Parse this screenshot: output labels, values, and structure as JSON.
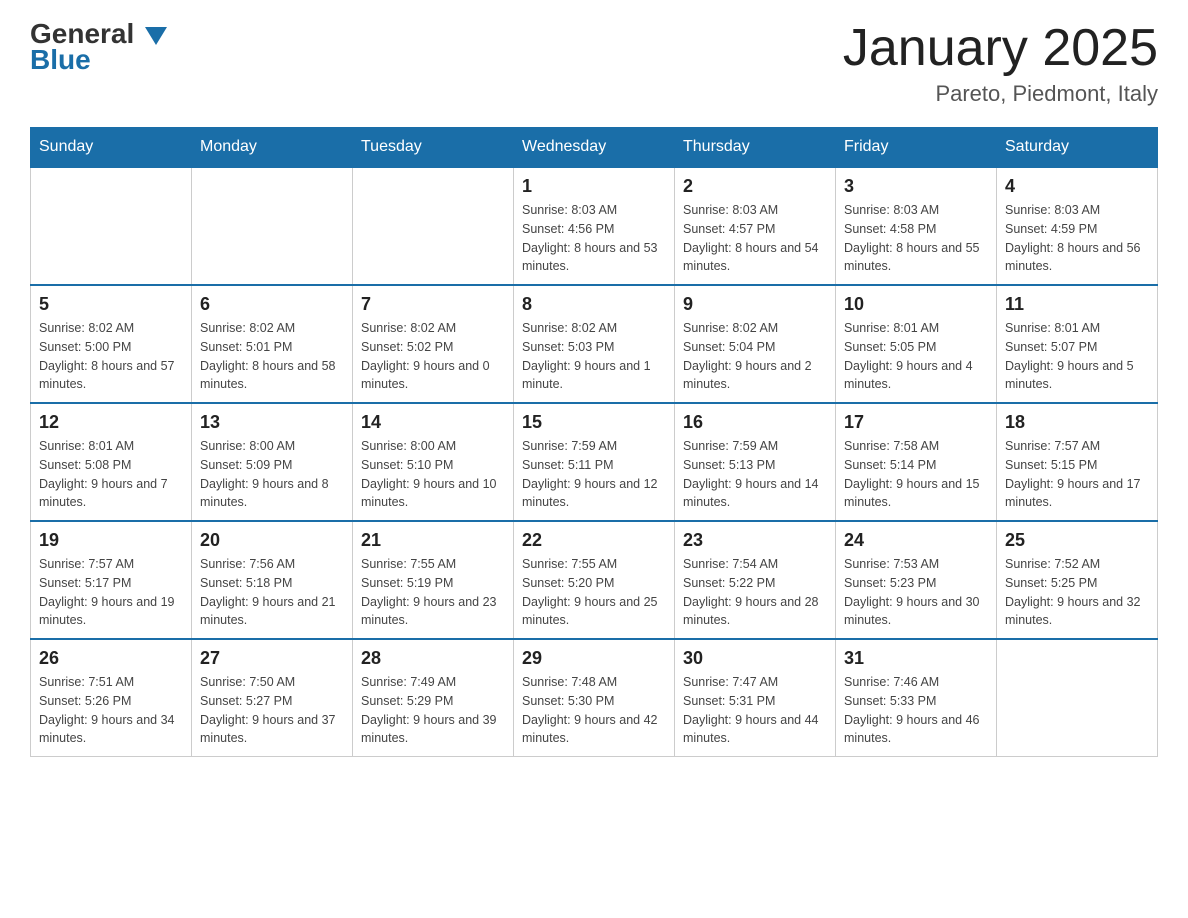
{
  "header": {
    "logo_general": "General",
    "logo_blue": "Blue",
    "title": "January 2025",
    "subtitle": "Pareto, Piedmont, Italy"
  },
  "days_of_week": [
    "Sunday",
    "Monday",
    "Tuesday",
    "Wednesday",
    "Thursday",
    "Friday",
    "Saturday"
  ],
  "weeks": [
    [
      {
        "day": "",
        "sunrise": "",
        "sunset": "",
        "daylight": ""
      },
      {
        "day": "",
        "sunrise": "",
        "sunset": "",
        "daylight": ""
      },
      {
        "day": "",
        "sunrise": "",
        "sunset": "",
        "daylight": ""
      },
      {
        "day": "1",
        "sunrise": "Sunrise: 8:03 AM",
        "sunset": "Sunset: 4:56 PM",
        "daylight": "Daylight: 8 hours and 53 minutes."
      },
      {
        "day": "2",
        "sunrise": "Sunrise: 8:03 AM",
        "sunset": "Sunset: 4:57 PM",
        "daylight": "Daylight: 8 hours and 54 minutes."
      },
      {
        "day": "3",
        "sunrise": "Sunrise: 8:03 AM",
        "sunset": "Sunset: 4:58 PM",
        "daylight": "Daylight: 8 hours and 55 minutes."
      },
      {
        "day": "4",
        "sunrise": "Sunrise: 8:03 AM",
        "sunset": "Sunset: 4:59 PM",
        "daylight": "Daylight: 8 hours and 56 minutes."
      }
    ],
    [
      {
        "day": "5",
        "sunrise": "Sunrise: 8:02 AM",
        "sunset": "Sunset: 5:00 PM",
        "daylight": "Daylight: 8 hours and 57 minutes."
      },
      {
        "day": "6",
        "sunrise": "Sunrise: 8:02 AM",
        "sunset": "Sunset: 5:01 PM",
        "daylight": "Daylight: 8 hours and 58 minutes."
      },
      {
        "day": "7",
        "sunrise": "Sunrise: 8:02 AM",
        "sunset": "Sunset: 5:02 PM",
        "daylight": "Daylight: 9 hours and 0 minutes."
      },
      {
        "day": "8",
        "sunrise": "Sunrise: 8:02 AM",
        "sunset": "Sunset: 5:03 PM",
        "daylight": "Daylight: 9 hours and 1 minute."
      },
      {
        "day": "9",
        "sunrise": "Sunrise: 8:02 AM",
        "sunset": "Sunset: 5:04 PM",
        "daylight": "Daylight: 9 hours and 2 minutes."
      },
      {
        "day": "10",
        "sunrise": "Sunrise: 8:01 AM",
        "sunset": "Sunset: 5:05 PM",
        "daylight": "Daylight: 9 hours and 4 minutes."
      },
      {
        "day": "11",
        "sunrise": "Sunrise: 8:01 AM",
        "sunset": "Sunset: 5:07 PM",
        "daylight": "Daylight: 9 hours and 5 minutes."
      }
    ],
    [
      {
        "day": "12",
        "sunrise": "Sunrise: 8:01 AM",
        "sunset": "Sunset: 5:08 PM",
        "daylight": "Daylight: 9 hours and 7 minutes."
      },
      {
        "day": "13",
        "sunrise": "Sunrise: 8:00 AM",
        "sunset": "Sunset: 5:09 PM",
        "daylight": "Daylight: 9 hours and 8 minutes."
      },
      {
        "day": "14",
        "sunrise": "Sunrise: 8:00 AM",
        "sunset": "Sunset: 5:10 PM",
        "daylight": "Daylight: 9 hours and 10 minutes."
      },
      {
        "day": "15",
        "sunrise": "Sunrise: 7:59 AM",
        "sunset": "Sunset: 5:11 PM",
        "daylight": "Daylight: 9 hours and 12 minutes."
      },
      {
        "day": "16",
        "sunrise": "Sunrise: 7:59 AM",
        "sunset": "Sunset: 5:13 PM",
        "daylight": "Daylight: 9 hours and 14 minutes."
      },
      {
        "day": "17",
        "sunrise": "Sunrise: 7:58 AM",
        "sunset": "Sunset: 5:14 PM",
        "daylight": "Daylight: 9 hours and 15 minutes."
      },
      {
        "day": "18",
        "sunrise": "Sunrise: 7:57 AM",
        "sunset": "Sunset: 5:15 PM",
        "daylight": "Daylight: 9 hours and 17 minutes."
      }
    ],
    [
      {
        "day": "19",
        "sunrise": "Sunrise: 7:57 AM",
        "sunset": "Sunset: 5:17 PM",
        "daylight": "Daylight: 9 hours and 19 minutes."
      },
      {
        "day": "20",
        "sunrise": "Sunrise: 7:56 AM",
        "sunset": "Sunset: 5:18 PM",
        "daylight": "Daylight: 9 hours and 21 minutes."
      },
      {
        "day": "21",
        "sunrise": "Sunrise: 7:55 AM",
        "sunset": "Sunset: 5:19 PM",
        "daylight": "Daylight: 9 hours and 23 minutes."
      },
      {
        "day": "22",
        "sunrise": "Sunrise: 7:55 AM",
        "sunset": "Sunset: 5:20 PM",
        "daylight": "Daylight: 9 hours and 25 minutes."
      },
      {
        "day": "23",
        "sunrise": "Sunrise: 7:54 AM",
        "sunset": "Sunset: 5:22 PM",
        "daylight": "Daylight: 9 hours and 28 minutes."
      },
      {
        "day": "24",
        "sunrise": "Sunrise: 7:53 AM",
        "sunset": "Sunset: 5:23 PM",
        "daylight": "Daylight: 9 hours and 30 minutes."
      },
      {
        "day": "25",
        "sunrise": "Sunrise: 7:52 AM",
        "sunset": "Sunset: 5:25 PM",
        "daylight": "Daylight: 9 hours and 32 minutes."
      }
    ],
    [
      {
        "day": "26",
        "sunrise": "Sunrise: 7:51 AM",
        "sunset": "Sunset: 5:26 PM",
        "daylight": "Daylight: 9 hours and 34 minutes."
      },
      {
        "day": "27",
        "sunrise": "Sunrise: 7:50 AM",
        "sunset": "Sunset: 5:27 PM",
        "daylight": "Daylight: 9 hours and 37 minutes."
      },
      {
        "day": "28",
        "sunrise": "Sunrise: 7:49 AM",
        "sunset": "Sunset: 5:29 PM",
        "daylight": "Daylight: 9 hours and 39 minutes."
      },
      {
        "day": "29",
        "sunrise": "Sunrise: 7:48 AM",
        "sunset": "Sunset: 5:30 PM",
        "daylight": "Daylight: 9 hours and 42 minutes."
      },
      {
        "day": "30",
        "sunrise": "Sunrise: 7:47 AM",
        "sunset": "Sunset: 5:31 PM",
        "daylight": "Daylight: 9 hours and 44 minutes."
      },
      {
        "day": "31",
        "sunrise": "Sunrise: 7:46 AM",
        "sunset": "Sunset: 5:33 PM",
        "daylight": "Daylight: 9 hours and 46 minutes."
      },
      {
        "day": "",
        "sunrise": "",
        "sunset": "",
        "daylight": ""
      }
    ]
  ]
}
